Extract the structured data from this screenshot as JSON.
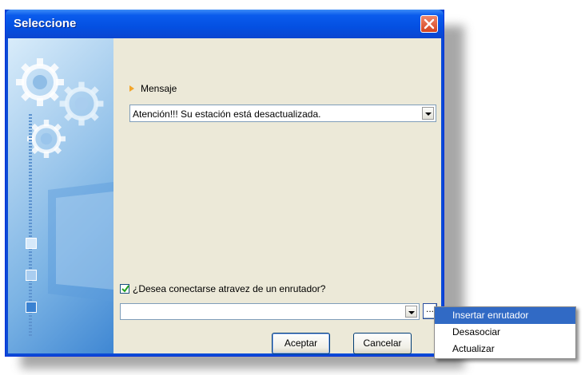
{
  "window": {
    "title": "Seleccione",
    "close_icon": "close-icon"
  },
  "message": {
    "label": "Mensaje",
    "value": "Atención!!! Su estación está desactualizada."
  },
  "router": {
    "checkbox_label": "¿Desea conectarse atravez de un enrutador?",
    "checked": true,
    "value": "",
    "ellipsis_label": "..."
  },
  "buttons": {
    "ok": "Aceptar",
    "cancel": "Cancelar"
  },
  "context_menu": {
    "items": [
      "Insertar enrutador",
      "Desasociar",
      "Actualizar"
    ],
    "highlighted": "Insertar enrutador"
  },
  "colors": {
    "titlebar": "#0450e2",
    "dialog_bg": "#ece9d8",
    "menu_highlight": "#316ac5"
  }
}
